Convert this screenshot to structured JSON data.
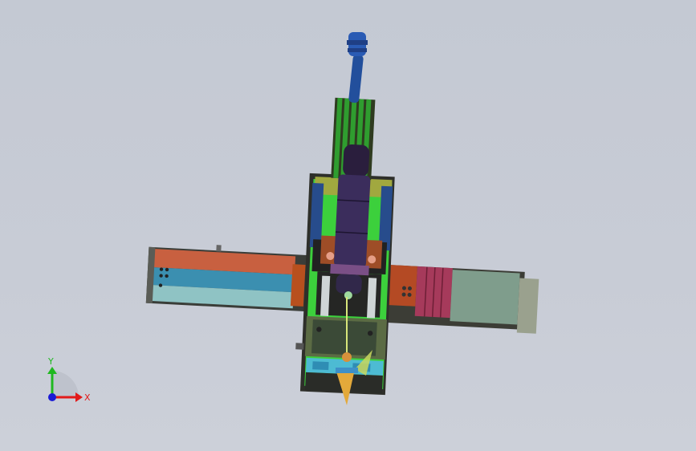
{
  "viewport": {
    "background": "#c7ccd5",
    "view_mode": "shaded-with-edges",
    "model_name": ""
  },
  "triad": {
    "x_label": "X",
    "y_label": "Y",
    "x_color": "#e21a1a",
    "y_color": "#1fb81f",
    "z_color": "#1a1ad6"
  },
  "model": {
    "parts": [
      "blue-cable-connector",
      "green-ribbed-heat-sink",
      "purple-laser-head",
      "green-mounting-plate",
      "left-linear-axis-module",
      "right-motor-axis-module",
      "nozzle-assembly"
    ]
  }
}
